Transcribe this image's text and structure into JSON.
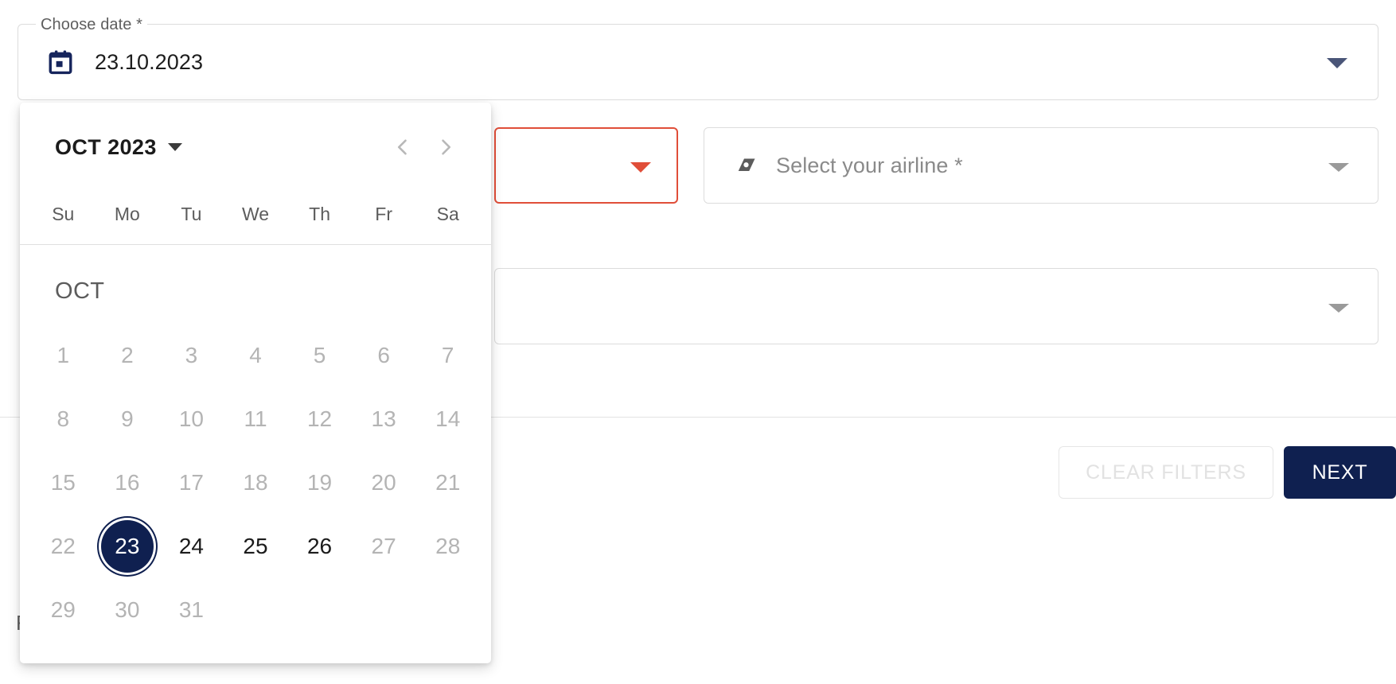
{
  "date_field": {
    "legend": "Choose date *",
    "value": "23.10.2023",
    "icon": "calendar-icon",
    "caret_icon": "chevron-down-icon",
    "caret_color": "#4a5578"
  },
  "route_field": {
    "value": "",
    "caret_icon": "chevron-down-icon",
    "state": "error",
    "error_color": "#e04e39"
  },
  "airline_field": {
    "placeholder": "Select your airline *",
    "icon": "airline-tailfin-icon",
    "caret_icon": "chevron-down-icon",
    "caret_color": "#9a9a9a"
  },
  "flight_field": {
    "value": "",
    "caret_icon": "chevron-down-icon",
    "caret_color": "#9a9a9a"
  },
  "background_text": {
    "bottom_left_partial": "F"
  },
  "footer": {
    "clear_filters_label": "CLEAR FILTERS",
    "clear_filters_disabled": true,
    "next_label": "NEXT",
    "next_color": "#0f2050"
  },
  "calendar": {
    "month_year_label": "OCT 2023",
    "month_year_caret": "chevron-down-icon",
    "prev_icon": "chevron-left-icon",
    "next_icon": "chevron-right-icon",
    "weekdays": [
      "Su",
      "Mo",
      "Tu",
      "We",
      "Th",
      "Fr",
      "Sa"
    ],
    "month_label": "OCT",
    "selected_day": 23,
    "enabled_days": [
      23,
      24,
      25,
      26
    ],
    "selected_color": "#0f2050",
    "weeks": [
      [
        {
          "n": "1"
        },
        {
          "n": "2"
        },
        {
          "n": "3"
        },
        {
          "n": "4"
        },
        {
          "n": "5"
        },
        {
          "n": "6"
        },
        {
          "n": "7"
        }
      ],
      [
        {
          "n": "8"
        },
        {
          "n": "9"
        },
        {
          "n": "10"
        },
        {
          "n": "11"
        },
        {
          "n": "12"
        },
        {
          "n": "13"
        },
        {
          "n": "14"
        }
      ],
      [
        {
          "n": "15"
        },
        {
          "n": "16"
        },
        {
          "n": "17"
        },
        {
          "n": "18"
        },
        {
          "n": "19"
        },
        {
          "n": "20"
        },
        {
          "n": "21"
        }
      ],
      [
        {
          "n": "22"
        },
        {
          "n": "23"
        },
        {
          "n": "24"
        },
        {
          "n": "25"
        },
        {
          "n": "26"
        },
        {
          "n": "27"
        },
        {
          "n": "28"
        }
      ],
      [
        {
          "n": "29"
        },
        {
          "n": "30"
        },
        {
          "n": "31"
        },
        {
          "n": ""
        },
        {
          "n": ""
        },
        {
          "n": ""
        },
        {
          "n": ""
        }
      ]
    ]
  }
}
